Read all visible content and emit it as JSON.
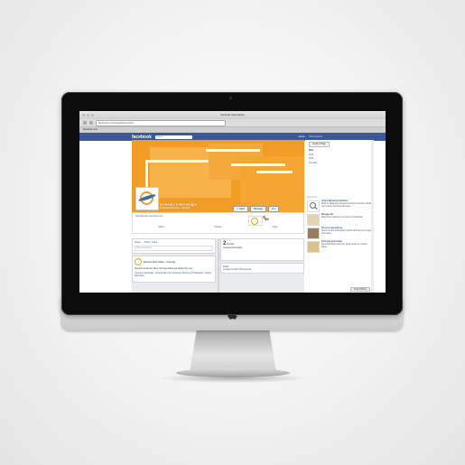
{
  "browser": {
    "title": "Genesis Internships",
    "url": "facebook.com/GenesisInternships",
    "tab": "facebook.com"
  },
  "facebook": {
    "logo": "facebook",
    "search_placeholder": "Search",
    "nav_home": "Home",
    "nav_extra": "Find Friends",
    "page_name": "Genesis Internships",
    "page_category": "Professional Services · Recruiter",
    "like_button": "✓ Liked",
    "message_button": "Message",
    "more_button": "⚙ ▾",
    "page_url": "http://genesis-internships.com",
    "tabs": [
      "About",
      "Photos",
      "Likes"
    ],
    "likes_count": "59",
    "status_tabs": [
      "Status",
      "Photo / Video"
    ],
    "write_placeholder": "Write something...",
    "post_author": "Genesis Internships",
    "post_time": "Yesterday",
    "post_text": "Attention students: More cool internships are waiting for you!",
    "post_link": "Genesis Internships - Pursuit with The Consumer Director of Publication - Higher Education",
    "friends_count": "2",
    "friends_label": "Friends",
    "recent_label": "Genesis Internships",
    "posts_label": "Posts",
    "publisher_label": "Google Provider Professional"
  },
  "sidebar": {
    "button": "Create a Page",
    "nav": [
      "Now",
      "2013",
      "2012",
      "Founded"
    ],
    "section": "Sponsored",
    "ads": [
      {
        "title": "Twitter Marketing Software",
        "text": "Build on Marketing. Recommended by Experts. Handle your social marketing with ease."
      },
      {
        "title": "Manage Ads",
        "text": "Reach the customers you want on Facebook."
      },
      {
        "title": "Discover Advertising",
        "text": "Check out the advertising channel that fits your budget and goals."
      },
      {
        "title": "Kentucky Internships",
        "text": "Find internships near you. Apply online in minutes today."
      }
    ],
    "chat": "Chat (Offline)"
  }
}
